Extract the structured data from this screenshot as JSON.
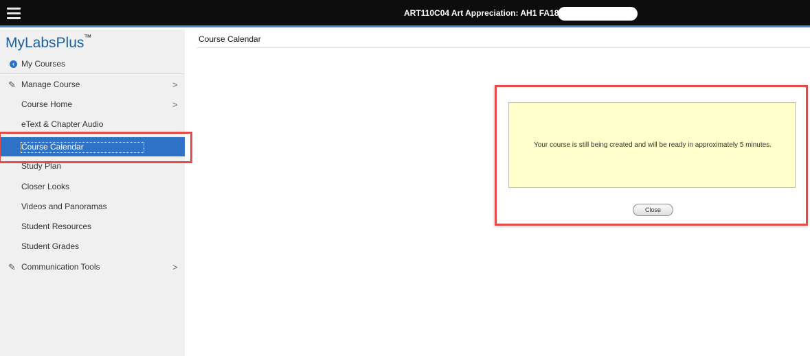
{
  "topbar": {
    "course_title": "ART110C04 Art Appreciation: AH1 FA18"
  },
  "sidebar": {
    "logo": "MyLabsPlus",
    "logo_mark": "™",
    "items": [
      {
        "label": "My Courses",
        "icon": "back-circle-icon"
      },
      {
        "label": "Manage Course",
        "icon": "pen-icon",
        "chevron": ">"
      },
      {
        "label": "Course Home",
        "chevron": ">"
      },
      {
        "label": "eText & Chapter Audio"
      },
      {
        "label": "Course Calendar",
        "active": true
      },
      {
        "label": "Study Plan"
      },
      {
        "label": "Closer Looks"
      },
      {
        "label": "Videos and Panoramas"
      },
      {
        "label": "Student Resources"
      },
      {
        "label": "Student Grades"
      },
      {
        "label": "Communication Tools",
        "icon": "pen-icon",
        "chevron": ">"
      }
    ]
  },
  "main": {
    "title": "Course Calendar"
  },
  "dialog": {
    "message": "Your course is still being created and will be ready in approximately 5 minutes.",
    "close_label": "Close"
  },
  "colors": {
    "topbar": "#0d0d0d",
    "accent": "#2f73c9",
    "highlight": "#e24b47",
    "message_bg": "#ffffcc"
  }
}
